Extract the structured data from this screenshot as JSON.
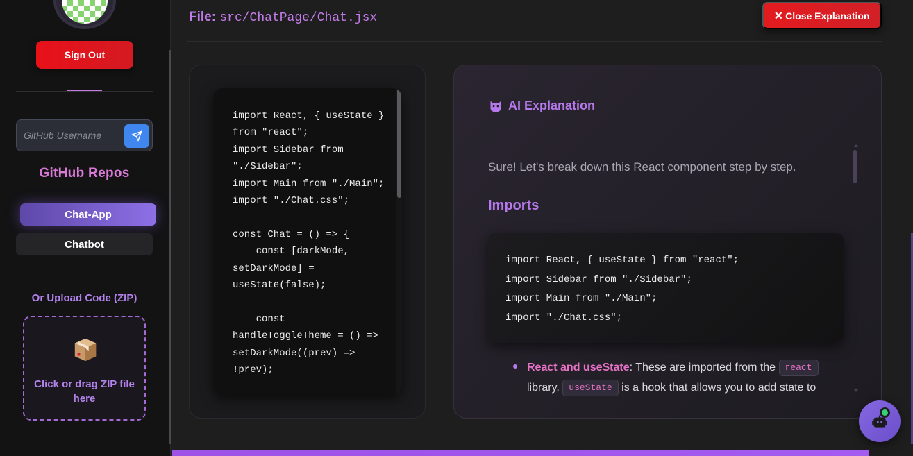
{
  "sidebar": {
    "sign_out_label": "Sign Out",
    "github_input_placeholder": "GitHub Username",
    "github_input_value": "",
    "repos_title": "GitHub Repos",
    "repos": [
      {
        "label": "Chat-App",
        "active": true
      },
      {
        "label": "Chatbot",
        "active": false
      }
    ],
    "upload_title": "Or Upload Code (ZIP)",
    "dropzone_text": "Click or drag ZIP file here"
  },
  "header": {
    "file_label": "File:",
    "file_path": "src/ChatPage/Chat.jsx",
    "close_label": "Close Explanation",
    "close_icon": "×"
  },
  "code_viewer": {
    "code": "import React, { useState } from \"react\";\nimport Sidebar from \"./Sidebar\";\nimport Main from \"./Main\";\nimport \"./Chat.css\";\n\nconst Chat = () => {\n    const [darkMode, setDarkMode] = useState(false);\n\n    const handleToggleTheme = () => setDarkMode((prev) => !prev);"
  },
  "explanation": {
    "title": "AI Explanation",
    "intro": "Sure! Let's break down this React component step by step.",
    "section_heading": "Imports",
    "code_block": "import React, { useState } from \"react\";\nimport Sidebar from \"./Sidebar\";\nimport Main from \"./Main\";\nimport \"./Chat.css\";",
    "bullet": {
      "strong": "React and useState",
      "text_1": ": These are imported from the ",
      "pill_1": "react",
      "text_2": " library. ",
      "pill_2": "useState",
      "text_3": " is a hook that allows you to add state to"
    }
  },
  "colors": {
    "accent_purple": "#b579ec",
    "danger_red": "#e21b1f",
    "status_green": "#34d37a"
  },
  "icons": [
    "send-icon",
    "box-icon",
    "close-icon",
    "bot-icon",
    "owl-icon"
  ]
}
